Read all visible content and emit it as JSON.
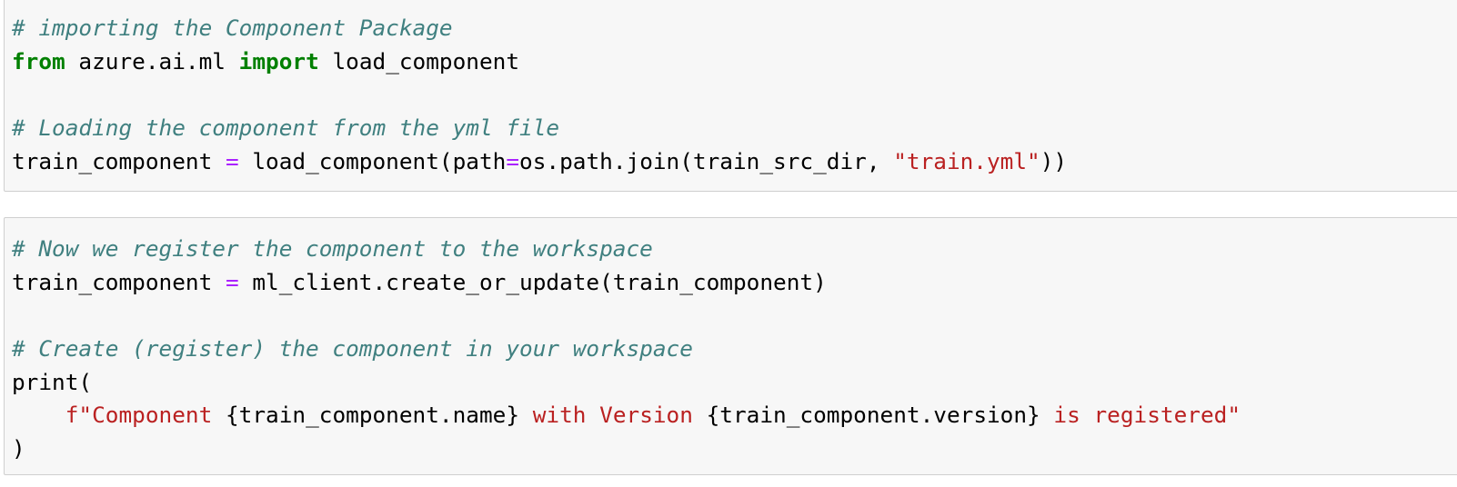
{
  "cells": [
    {
      "lines": [
        [
          {
            "t": "# importing the Component Package",
            "c": "cm"
          }
        ],
        [
          {
            "t": "from",
            "c": "kw"
          },
          {
            "t": " azure.ai.ml ",
            "c": "tx"
          },
          {
            "t": "import",
            "c": "kw"
          },
          {
            "t": " load_component",
            "c": "tx"
          }
        ],
        [],
        [
          {
            "t": "# Loading the component from the yml file",
            "c": "cm"
          }
        ],
        [
          {
            "t": "train_component ",
            "c": "tx"
          },
          {
            "t": "=",
            "c": "op"
          },
          {
            "t": " load_component(path",
            "c": "tx"
          },
          {
            "t": "=",
            "c": "op"
          },
          {
            "t": "os.path.join(train_src_dir, ",
            "c": "tx"
          },
          {
            "t": "\"train.yml\"",
            "c": "st"
          },
          {
            "t": "))",
            "c": "tx"
          }
        ]
      ]
    },
    {
      "lines": [
        [
          {
            "t": "# Now we register the component to the workspace",
            "c": "cm"
          }
        ],
        [
          {
            "t": "train_component ",
            "c": "tx"
          },
          {
            "t": "=",
            "c": "op"
          },
          {
            "t": " ml_client.create_or_update(train_component)",
            "c": "tx"
          }
        ],
        [],
        [
          {
            "t": "# Create (register) the component in your workspace",
            "c": "cm"
          }
        ],
        [
          {
            "t": "print(",
            "c": "tx"
          }
        ],
        [
          {
            "t": "    ",
            "c": "tx"
          },
          {
            "t": "f\"Component ",
            "c": "st"
          },
          {
            "t": "{train_component.name}",
            "c": "tx"
          },
          {
            "t": " with Version ",
            "c": "st"
          },
          {
            "t": "{train_component.version}",
            "c": "tx"
          },
          {
            "t": " is registered\"",
            "c": "st"
          }
        ],
        [
          {
            "t": ")",
            "c": "tx"
          }
        ]
      ]
    }
  ]
}
